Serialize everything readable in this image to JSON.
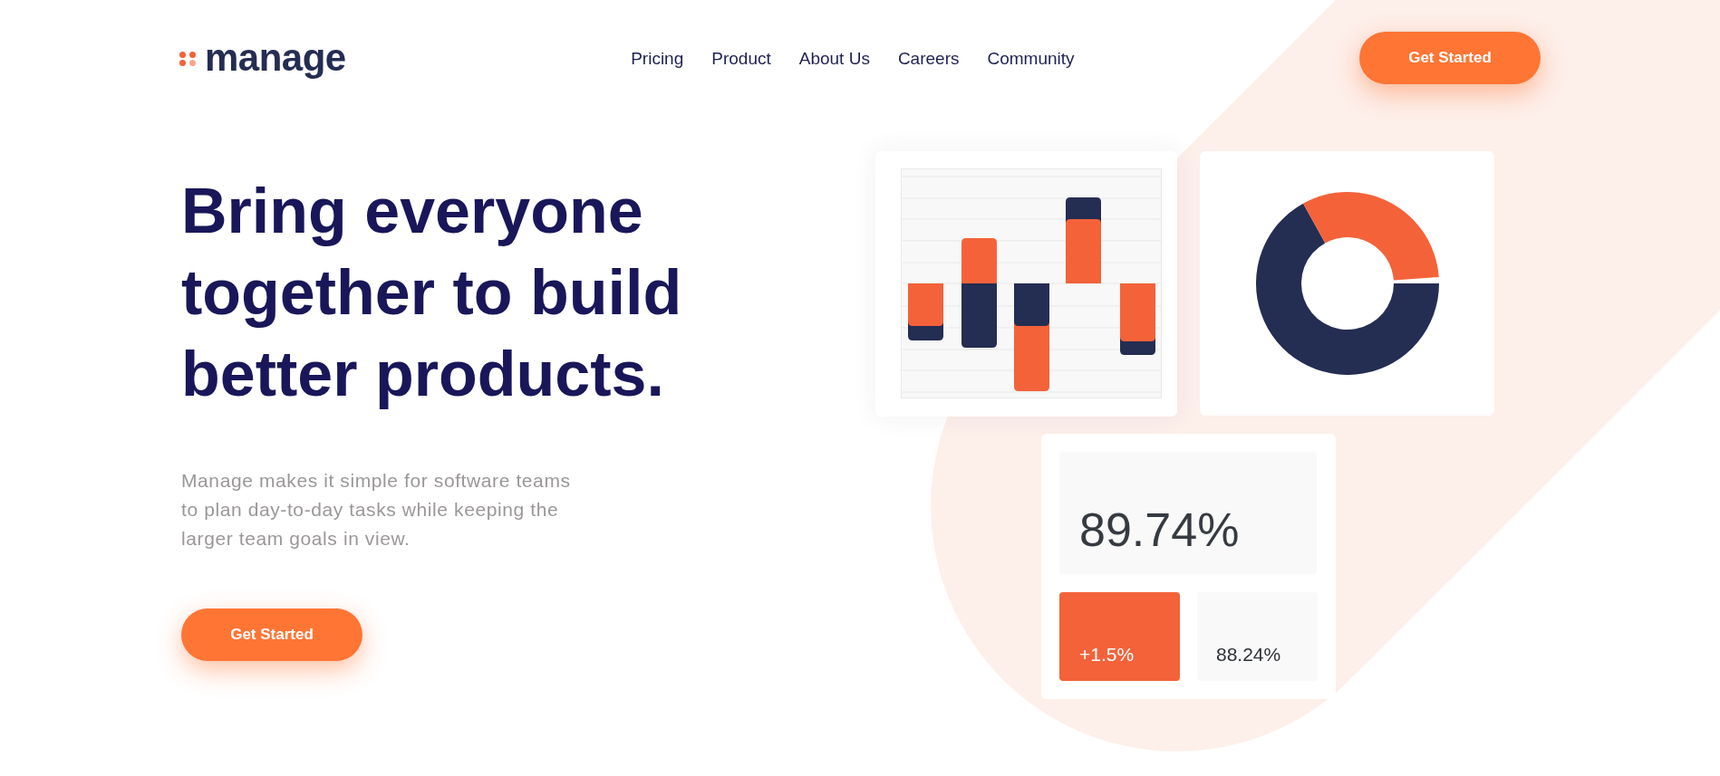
{
  "logo": {
    "text": "manage"
  },
  "nav": {
    "links": [
      {
        "label": "Pricing"
      },
      {
        "label": "Product"
      },
      {
        "label": "About Us"
      },
      {
        "label": "Careers"
      },
      {
        "label": "Community"
      }
    ],
    "button": "Get Started"
  },
  "hero": {
    "heading": "Bring everyone together to build better products.",
    "description": "Manage makes it simple for software teams to plan day-to-day tasks while keeping the larger team goals in view.",
    "button": "Get Started"
  },
  "stats_card": {
    "main_value": "89.74%",
    "tiles": [
      {
        "value": "+1.5%",
        "highlighted": true
      },
      {
        "value": "88.24%",
        "highlighted": false
      }
    ]
  }
}
